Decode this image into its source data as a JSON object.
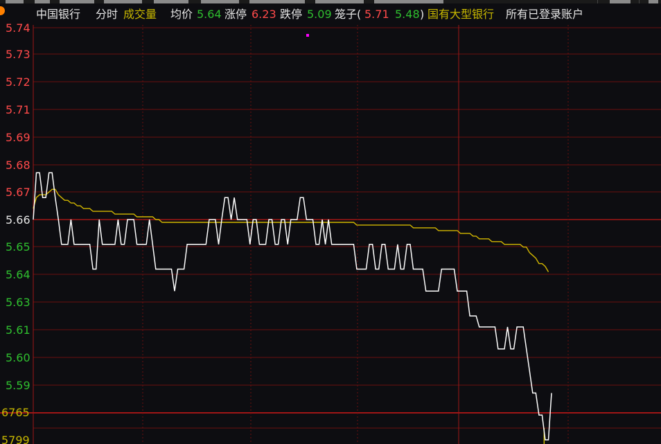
{
  "header": {
    "stock_name": "中国银行",
    "period": "分时",
    "indicator": "成交量",
    "avg_label": "均价",
    "avg_value": "5.64",
    "limit_up_label": "涨停",
    "limit_up_value": "6.23",
    "limit_down_label": "跌停",
    "limit_down_value": "5.09",
    "cage_label": "笼子(",
    "cage_high": "5.71",
    "cage_low": "5.48",
    "cage_close": ")",
    "sector": "国有大型银行",
    "account": "所有已登录账户"
  },
  "colors": {
    "background": "#0d0d11",
    "grid": "#6b0e0e",
    "grid_strong": "#a01616",
    "price_line": "#ffffff",
    "avg_line": "#d4b800",
    "up": "#ff4a4a",
    "down": "#2fbf2f",
    "volume": "#c8b800",
    "marker": "#ff00ff"
  },
  "chart_data": {
    "type": "line",
    "y_axis_labels": [
      {
        "value": "5.74",
        "color": "red"
      },
      {
        "value": "5.73",
        "color": "red"
      },
      {
        "value": "5.72",
        "color": "red"
      },
      {
        "value": "5.71",
        "color": "red"
      },
      {
        "value": "5.69",
        "color": "red"
      },
      {
        "value": "5.68",
        "color": "red"
      },
      {
        "value": "5.67",
        "color": "red"
      },
      {
        "value": "5.66",
        "color": "white"
      },
      {
        "value": "5.65",
        "color": "green"
      },
      {
        "value": "5.64",
        "color": "green"
      },
      {
        "value": "5.63",
        "color": "green"
      },
      {
        "value": "5.61",
        "color": "green"
      },
      {
        "value": "5.60",
        "color": "green"
      },
      {
        "value": "5.59",
        "color": "green"
      }
    ],
    "volume_axis_labels": [
      "6765",
      "5799"
    ],
    "series": [
      {
        "name": "price",
        "values": [
          5.66,
          5.677,
          5.677,
          5.668,
          5.668,
          5.677,
          5.677,
          5.668,
          5.66,
          5.651,
          5.651,
          5.651,
          5.66,
          5.651,
          5.651,
          5.651,
          5.651,
          5.651,
          5.651,
          5.642,
          5.642,
          5.66,
          5.651,
          5.651,
          5.651,
          5.651,
          5.651,
          5.66,
          5.651,
          5.651,
          5.66,
          5.66,
          5.66,
          5.651,
          5.651,
          5.651,
          5.651,
          5.66,
          5.651,
          5.642,
          5.642,
          5.642,
          5.642,
          5.642,
          5.642,
          5.634,
          5.642,
          5.642,
          5.642,
          5.651,
          5.651,
          5.651,
          5.651,
          5.651,
          5.651,
          5.651,
          5.66,
          5.66,
          5.66,
          5.651,
          5.66,
          5.668,
          5.668,
          5.66,
          5.668,
          5.66,
          5.66,
          5.66,
          5.66,
          5.651,
          5.66,
          5.66,
          5.651,
          5.651,
          5.651,
          5.66,
          5.66,
          5.651,
          5.651,
          5.66,
          5.66,
          5.651,
          5.66,
          5.66,
          5.66,
          5.668,
          5.668,
          5.66,
          5.66,
          5.66,
          5.651,
          5.651,
          5.66,
          5.651,
          5.66,
          5.651,
          5.651,
          5.651,
          5.651,
          5.651,
          5.651,
          5.651,
          5.651,
          5.642,
          5.642,
          5.642,
          5.642,
          5.651,
          5.651,
          5.642,
          5.642,
          5.651,
          5.651,
          5.642,
          5.642,
          5.642,
          5.651,
          5.642,
          5.642,
          5.651,
          5.651,
          5.642,
          5.642,
          5.642,
          5.642,
          5.634,
          5.634,
          5.634,
          5.634,
          5.634,
          5.642,
          5.642,
          5.642,
          5.642,
          5.642,
          5.634,
          5.634,
          5.634,
          5.634,
          5.625,
          5.625,
          5.625,
          5.621,
          5.621,
          5.621,
          5.621,
          5.621,
          5.621,
          5.613,
          5.613,
          5.613,
          5.621,
          5.613,
          5.613,
          5.621,
          5.621,
          5.621,
          5.613,
          5.605,
          5.597,
          5.597,
          5.589,
          5.589,
          5.58,
          5.58,
          5.597
        ]
      },
      {
        "name": "avg",
        "values": [
          5.664,
          5.668,
          5.669,
          5.669,
          5.669,
          5.67,
          5.671,
          5.671,
          5.669,
          5.668,
          5.667,
          5.667,
          5.666,
          5.666,
          5.665,
          5.665,
          5.664,
          5.664,
          5.664,
          5.663,
          5.663,
          5.663,
          5.663,
          5.663,
          5.663,
          5.663,
          5.662,
          5.662,
          5.662,
          5.662,
          5.662,
          5.662,
          5.662,
          5.661,
          5.661,
          5.661,
          5.661,
          5.661,
          5.661,
          5.66,
          5.66,
          5.659,
          5.659,
          5.659,
          5.659,
          5.659,
          5.659,
          5.659,
          5.659,
          5.659,
          5.659,
          5.659,
          5.659,
          5.659,
          5.659,
          5.659,
          5.659,
          5.659,
          5.659,
          5.659,
          5.659,
          5.659,
          5.659,
          5.659,
          5.659,
          5.659,
          5.659,
          5.659,
          5.659,
          5.659,
          5.659,
          5.659,
          5.659,
          5.659,
          5.659,
          5.659,
          5.659,
          5.659,
          5.659,
          5.659,
          5.659,
          5.659,
          5.659,
          5.659,
          5.659,
          5.659,
          5.659,
          5.659,
          5.659,
          5.659,
          5.659,
          5.659,
          5.659,
          5.659,
          5.659,
          5.659,
          5.659,
          5.659,
          5.659,
          5.659,
          5.659,
          5.659,
          5.659,
          5.658,
          5.658,
          5.658,
          5.658,
          5.658,
          5.658,
          5.658,
          5.658,
          5.658,
          5.658,
          5.658,
          5.658,
          5.658,
          5.658,
          5.658,
          5.658,
          5.658,
          5.658,
          5.657,
          5.657,
          5.657,
          5.657,
          5.657,
          5.657,
          5.657,
          5.657,
          5.656,
          5.656,
          5.656,
          5.656,
          5.656,
          5.656,
          5.656,
          5.655,
          5.655,
          5.655,
          5.655,
          5.654,
          5.654,
          5.653,
          5.653,
          5.653,
          5.653,
          5.652,
          5.652,
          5.652,
          5.652,
          5.651,
          5.651,
          5.651,
          5.651,
          5.651,
          5.651,
          5.65,
          5.65,
          5.648,
          5.647,
          5.646,
          5.644,
          5.644,
          5.643,
          5.641
        ]
      }
    ],
    "volume": [
      0,
      0,
      0,
      0,
      0,
      0,
      0,
      0,
      0,
      0,
      0,
      0,
      0,
      0,
      0,
      0,
      0,
      0,
      0,
      0,
      0,
      0,
      0,
      0,
      0,
      0,
      0,
      0,
      0,
      0,
      0,
      0,
      0,
      0,
      0,
      0,
      0,
      0,
      0,
      0,
      0,
      0,
      0,
      0,
      0,
      0,
      0,
      0,
      0,
      0,
      0,
      0,
      0,
      0,
      0,
      0,
      0,
      0,
      0,
      0,
      0,
      0,
      0,
      0,
      0,
      0,
      0,
      0,
      0,
      0,
      0,
      0,
      0,
      0,
      0,
      0,
      0,
      0,
      0,
      0,
      0,
      0,
      0,
      0,
      0,
      0,
      0,
      0,
      0,
      0,
      0,
      0,
      0,
      0,
      0,
      0,
      0,
      0,
      0,
      0,
      0,
      0,
      0,
      0,
      0,
      0,
      0,
      0,
      0,
      0,
      0,
      0,
      0,
      0,
      0,
      0,
      0,
      0,
      0,
      0,
      0,
      0,
      0,
      0,
      0,
      0,
      0,
      0,
      0,
      0,
      0,
      0,
      0,
      0,
      0,
      0,
      0,
      0,
      0,
      0,
      0,
      0,
      0,
      0,
      0,
      0,
      0,
      0,
      0,
      0,
      0,
      0,
      0,
      0,
      0,
      0,
      0,
      0,
      0,
      0,
      0,
      0,
      0,
      0,
      0,
      0,
      0,
      5800
    ]
  }
}
